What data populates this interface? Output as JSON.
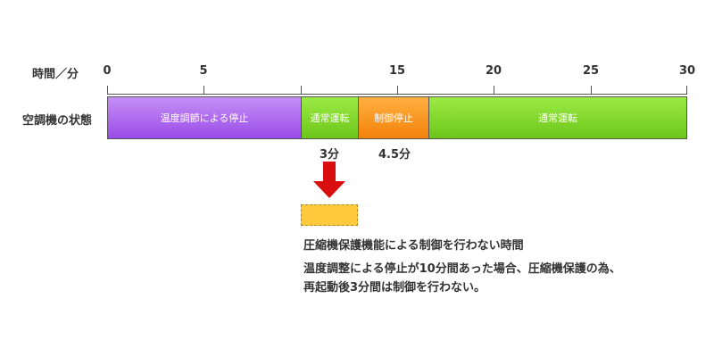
{
  "header": {
    "axis_label": "時間／分",
    "row_label": "空調機の状態"
  },
  "ticks": [
    "0",
    "5",
    "15",
    "20",
    "25",
    "30"
  ],
  "segments": [
    {
      "label": "温度調節による停止",
      "start": 0,
      "end": 10,
      "color": "purple"
    },
    {
      "label": "通常運転",
      "start": 10,
      "end": 13,
      "color": "green"
    },
    {
      "label": "制御停止",
      "start": 13,
      "end": 16.5,
      "color": "orange"
    },
    {
      "label": "通常運転",
      "start": 16.5,
      "end": 30,
      "color": "green"
    }
  ],
  "durations": [
    "3分",
    "4.5分"
  ],
  "colors": {
    "purple": "#9a4ce8",
    "green": "#6ec61a",
    "orange": "#f3820a",
    "arrow": "#d90f0f",
    "legend_fill": "#fec93a"
  },
  "legend": {
    "title": "圧縮機保護機能による制御を行わない時間",
    "description_line1": "温度調整による停止が10分間あった場合、圧縮機保護の為、",
    "description_line2": "再起動後3分間は制御を行わない。"
  }
}
